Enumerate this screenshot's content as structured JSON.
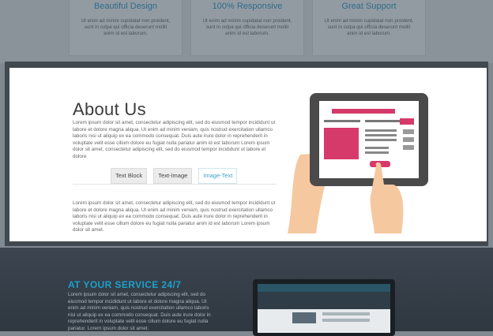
{
  "features": [
    {
      "title": "Beautiful Design",
      "text": "Ut enim ad minim cupidatat non proident, sunt in culpa qui officia deserunt mollit anim id est laborum."
    },
    {
      "title": "100% Responsive",
      "text": "Ut enim ad minim cupidatat non proident, sunt in culpa qui officia deserunt mollit anim id est laborum."
    },
    {
      "title": "Great Support",
      "text": "Ut enim ad minim cupidatat non proident, sunt in culpa qui officia deserunt mollit anim id est laborum."
    }
  ],
  "about": {
    "title": "About Us",
    "paragraph1": "Lorem ipsum dolor sit amet, consectetur adipiscing elit, sed do eiusmod tempor incididunt ut labore et dolore magna aliqua. Ut enim ad minim veniam, quis nostrud exercitation ullamco laboris nisi ut aliquip ex ea commodo consequat. Duis aute irure dolor in reprehenderit in voluptate velit esse cillum dolore eu fugiat nulla pariatur anim id est laborum Lorem ipsum dolor sit amet, consectetur adipiscing elit, sed do eiusmod tempor incididunt ut labore et dolore",
    "tabs": [
      "Text Block",
      "Text-Image",
      "Image-Text"
    ],
    "active_tab": "Image-Text",
    "paragraph2": "Lorem ipsum dolor sit amet, consectetur adipiscing elit, sed do eiusmod tempor incididunt ut labore et dolore magna aliqua. Ut enim ad minim veniam, quis nostrud exercitation ullamco laboris nisi ut aliquip ex ea commodo consequat. Duis aute irure dolor in reprehenderit in voluptate velit esse cillum dolore eu fugiat nulla pariatur anim id est laborum Lorem ipsum dolor sit amet."
  },
  "service": {
    "title": "AT YOUR SERVICE 24/7",
    "text": "Lorem ipsum dolor sit amet, consectetur adipiscing elit, sed do eiusmod tempor incididunt ut labore et dolore magna aliqua. Ut enim ad minim veniam, quis nostrud exercitation ullamco laboris nisi ut aliquip ex ea commodo consequat. Duis aute irure dolor in reprehenderit in voluptate velit esse cillum dolore eu fugiat nulla pariatur. Lorem ipsum dolor sit amet."
  },
  "icons": {
    "illustration": "tablet-hand-illustration",
    "monitor": "monitor-mockup-illustration"
  },
  "colors": {
    "accent": "#3aa3c9",
    "service_title": "#1e9fca",
    "tablet_pink": "#d63a6a"
  }
}
